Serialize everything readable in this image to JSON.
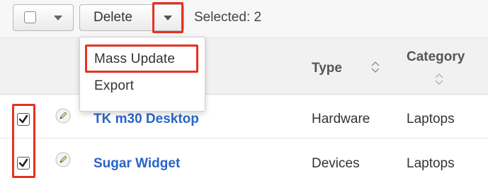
{
  "toolbar": {
    "delete_label": "Delete",
    "selected_text": "Selected: 2"
  },
  "menu": {
    "items": [
      "Mass Update",
      "Export"
    ]
  },
  "table": {
    "columns": [
      "Type",
      "Category"
    ],
    "rows": [
      {
        "name": "TK m30 Desktop",
        "type": "Hardware",
        "category": "Laptops",
        "checked": true
      },
      {
        "name": "Sugar Widget",
        "type": "Devices",
        "category": "Laptops",
        "checked": true
      }
    ]
  },
  "colors": {
    "highlight": "#e53222",
    "link": "#2a64c7"
  }
}
